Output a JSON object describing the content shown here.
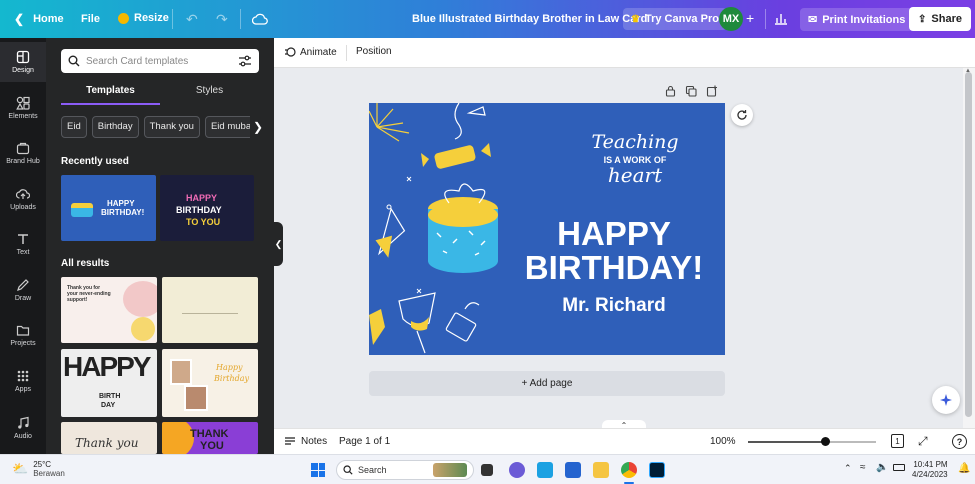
{
  "topbar": {
    "home": "Home",
    "file": "File",
    "resize": "Resize",
    "doc_title": "Blue Illustrated Birthday Brother in Law Card",
    "try_pro": "Try Canva Pro",
    "avatar": "MX",
    "print": "Print Invitations",
    "share": "Share"
  },
  "rail": {
    "items": [
      "Design",
      "Elements",
      "Brand Hub",
      "Uploads",
      "Text",
      "Draw",
      "Projects",
      "Apps",
      "Audio"
    ]
  },
  "panel": {
    "search_placeholder": "Search Card templates",
    "tabs": [
      "Templates",
      "Styles"
    ],
    "chips": [
      "Eid",
      "Birthday",
      "Thank you",
      "Eid mubarak"
    ],
    "recently_used": "Recently used",
    "all_results": "All results"
  },
  "editor": {
    "animate": "Animate",
    "position": "Position",
    "add_page": "+ Add page"
  },
  "card": {
    "script1": "Teaching",
    "script2": "IS A WORK OF",
    "script3": "heart",
    "line1": "HAPPY",
    "line2": "BIRTHDAY!",
    "name": "Mr. Richard",
    "bg": "#2f5fb9",
    "accent": "#f5cf3b",
    "cyan": "#3ab7e6"
  },
  "thumbs": {
    "t1": {
      "l1": "HAPPY",
      "l2": "BIRTHDAY!"
    },
    "t2": {
      "l1": "HAPPY",
      "l2": "BIRTHDAY",
      "l3": "TO YOU"
    },
    "t3": {
      "l1": "Thank you for",
      "l2": "your never-ending",
      "l3": "support!"
    },
    "t4": {
      "l1": "HAPPY",
      "l2": "BIRTH",
      "l3": "DAY"
    },
    "t5": {
      "l1": "Happy",
      "l2": "Birthday"
    },
    "t6": {
      "l1": "Thank you"
    },
    "t7": {
      "l1": "THANK",
      "l2": "YOU"
    }
  },
  "bottombar": {
    "notes": "Notes",
    "page": "Page 1 of 1",
    "zoom": "100%",
    "zoom_level": 0.6,
    "pages_count": "1",
    "help": "?"
  },
  "taskbar": {
    "temp": "25°C",
    "weather": "Berawan",
    "search": "Search",
    "time": "10:41 PM",
    "date": "4/24/2023"
  }
}
